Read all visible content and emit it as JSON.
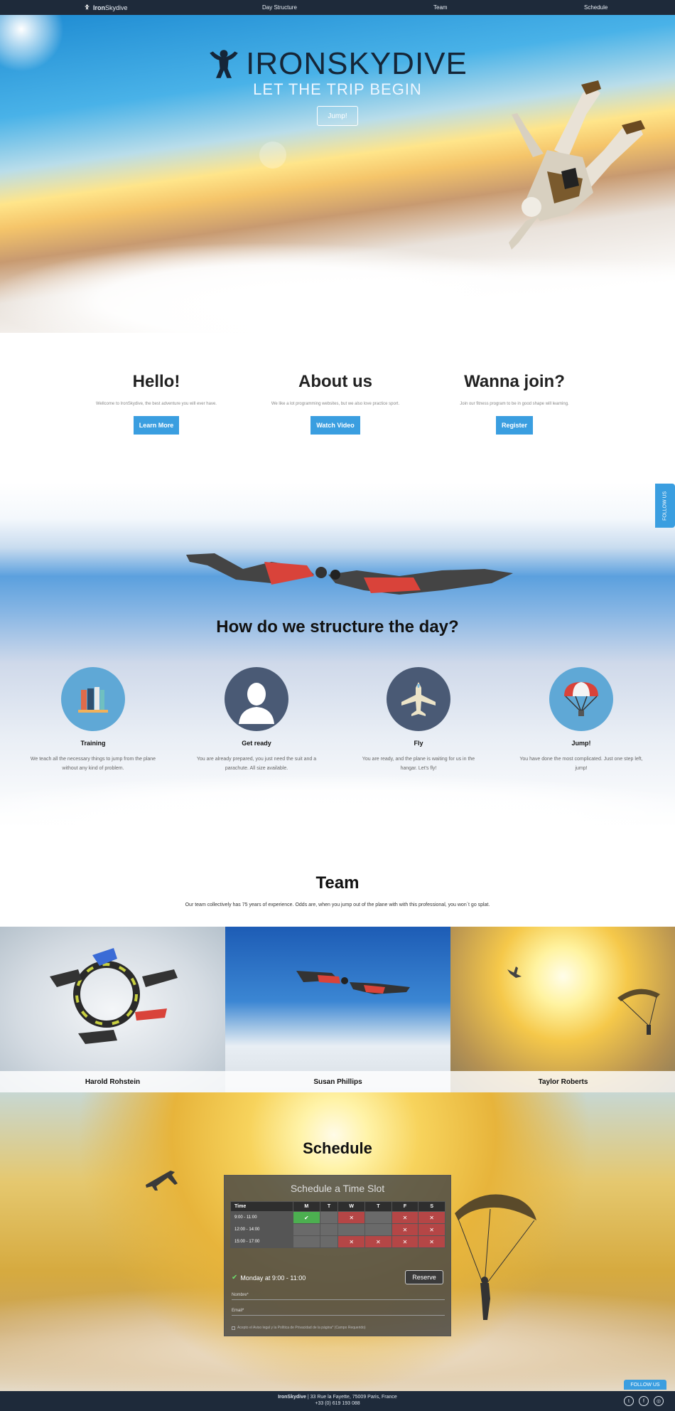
{
  "nav": {
    "brand_bold": "Iron",
    "brand_rest": "Skydive",
    "links": [
      "Day Structure",
      "Team",
      "Schedule"
    ]
  },
  "hero": {
    "title": "IRONSKYDIVE",
    "tagline": "LET THE TRIP BEGIN",
    "button": "Jump!"
  },
  "intro": [
    {
      "title": "Hello!",
      "text": "Wellcome to IronSkydive, the best adventure you will ever have.",
      "button": "Learn More"
    },
    {
      "title": "About us",
      "text": "We like a lot programming websites, but we also love practice sport.",
      "button": "Watch Video"
    },
    {
      "title": "Wanna join?",
      "text": "Join our fitness program to be in good shape will learning.",
      "button": "Register"
    }
  ],
  "structure": {
    "title": "How do we structure the day?",
    "steps": [
      {
        "title": "Training",
        "text": "We teach all the necessary things to jump from the plane without any kind of problem.",
        "icon": "books-icon"
      },
      {
        "title": "Get ready",
        "text": "You are already prepared, you just need the suit and a parachute. All size available.",
        "icon": "person-icon"
      },
      {
        "title": "Fly",
        "text": "You are ready, and the plane is waiting for us in the hangar. Let's fly!",
        "icon": "plane-icon"
      },
      {
        "title": "Jump!",
        "text": "You have done the most complicated. Just one step left, jump!",
        "icon": "parachute-icon"
      }
    ]
  },
  "follow_side": "FOLLOW US",
  "team": {
    "title": "Team",
    "description": "Our team collectively has 75 years of experience. Odds are, when you jump out of the plane with with this professional, you won´t go splat.",
    "members": [
      "Harold Rohstein",
      "Susan Phillips",
      "Taylor Roberts"
    ]
  },
  "schedule": {
    "title": "Schedule",
    "panel_title": "Schedule a Time Slot",
    "columns": [
      "Time",
      "M",
      "T",
      "W",
      "T",
      "F",
      "S"
    ],
    "rows": [
      {
        "time": "9:00 - 11:00",
        "cells": [
          "ok",
          "",
          "busy",
          "",
          "busy",
          "busy"
        ]
      },
      {
        "time": "12:00 - 14:00",
        "cells": [
          "",
          "",
          "",
          "",
          "busy",
          "busy"
        ]
      },
      {
        "time": "15:00 - 17:00",
        "cells": [
          "",
          "",
          "busy",
          "busy",
          "busy",
          "busy"
        ]
      }
    ],
    "selected": "Monday at 9:00 - 11:00",
    "reserve_button": "Reserve",
    "name_placeholder": "Nombre*",
    "email_placeholder": "Email*",
    "legal": "Acepto el Aviso legal y la Política de Privacidad de la página* (Campo Requerido)"
  },
  "follow_bottom": "FOLLOW US",
  "footer": {
    "brand": "IronSkydive",
    "address": " | 33 Rue la Fayette, 75009 Paris, France",
    "phone": "+33 (0) 619 193 088",
    "social": [
      "twitter-icon",
      "facebook-icon",
      "instagram-icon"
    ]
  }
}
